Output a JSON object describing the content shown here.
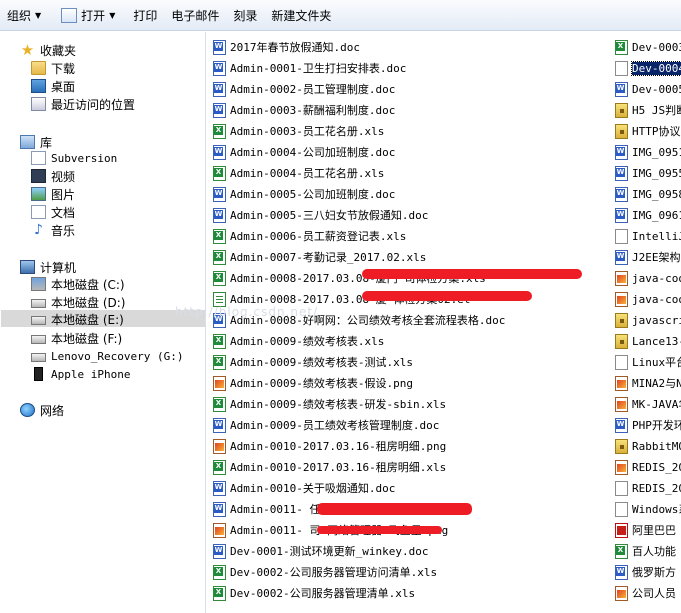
{
  "toolbar": {
    "organize": "组织",
    "open": "打开",
    "print": "打印",
    "email": "电子邮件",
    "burn": "刻录",
    "new_folder": "新建文件夹"
  },
  "nav": {
    "favorites": {
      "title": "收藏夹",
      "items": [
        "下载",
        "桌面",
        "最近访问的位置"
      ]
    },
    "libraries": {
      "title": "库",
      "items": [
        "Subversion",
        "视频",
        "图片",
        "文档",
        "音乐"
      ]
    },
    "computer": {
      "title": "计算机",
      "items": [
        "本地磁盘 (C:)",
        "本地磁盘 (D:)",
        "本地磁盘 (E:)",
        "本地磁盘 (F:)",
        "Lenovo_Recovery (G:)",
        "Apple iPhone"
      ]
    },
    "network": "网络"
  },
  "files_col1": [
    {
      "name": "2017年春节放假通知.doc",
      "type": "doc"
    },
    {
      "name": "Admin-0001-卫生打扫安排表.doc",
      "type": "doc"
    },
    {
      "name": "Admin-0002-员工管理制度.doc",
      "type": "doc"
    },
    {
      "name": "Admin-0003-薪酬福利制度.doc",
      "type": "doc"
    },
    {
      "name": "Admin-0003-员工花名册.xls",
      "type": "xls"
    },
    {
      "name": "Admin-0004-公司加班制度.doc",
      "type": "doc"
    },
    {
      "name": "Admin-0004-员工花名册.xls",
      "type": "xls"
    },
    {
      "name": "Admin-0005-公司加班制度.doc",
      "type": "doc"
    },
    {
      "name": "Admin-0005-三八妇女节放假通知.doc",
      "type": "doc"
    },
    {
      "name": "Admin-0006-员工薪资登记表.xls",
      "type": "xls"
    },
    {
      "name": "Admin-0007-考勤记录_2017.02.xls",
      "type": "xls"
    },
    {
      "name": "Admin-0008-2017.03.08-厦门                    司体检方案.xls",
      "type": "xls"
    },
    {
      "name": "Admin-0008-2017.03.08-厦                      体检方案02.et",
      "type": "et"
    },
    {
      "name": "Admin-0008-好啊网：公司绩效考核全套流程表格.doc",
      "type": "doc"
    },
    {
      "name": "Admin-0009-绩效考核表.xls",
      "type": "xls"
    },
    {
      "name": "Admin-0009-绩效考核表-测试.xls",
      "type": "xls"
    },
    {
      "name": "Admin-0009-绩效考核表-假设.png",
      "type": "png"
    },
    {
      "name": "Admin-0009-绩效考核表-研发-sbin.xls",
      "type": "xls"
    },
    {
      "name": "Admin-0009-员工绩效考核管理制度.doc",
      "type": "doc"
    },
    {
      "name": "Admin-0010-2017.03.16-租房明细.png",
      "type": "png"
    },
    {
      "name": "Admin-0010-2017.03.16-租房明细.xls",
      "type": "xls"
    },
    {
      "name": "Admin-0010-关于吸烟通知.doc",
      "type": "doc"
    },
    {
      "name": "Admin-0011-                           任命书.doc",
      "type": "doc"
    },
    {
      "name": "Admin-0011-                      司-网络管理器-飞鱼星.png",
      "type": "png"
    },
    {
      "name": "Dev-0001-测试环境更新_winkey.doc",
      "type": "doc"
    },
    {
      "name": "Dev-0002-公司服务器管理访问清单.xls",
      "type": "xls"
    },
    {
      "name": "Dev-0002-公司服务器管理清单.xls",
      "type": "xls"
    }
  ],
  "files_col2": [
    {
      "name": "Dev-0003",
      "type": "xls"
    },
    {
      "name": "Dev-0004",
      "type": "file",
      "selected": true
    },
    {
      "name": "Dev-0005",
      "type": "doc"
    },
    {
      "name": "H5 JS判断",
      "type": "lock"
    },
    {
      "name": "HTTP协议",
      "type": "lock"
    },
    {
      "name": "IMG_0951",
      "type": "doc"
    },
    {
      "name": "IMG_0955",
      "type": "doc"
    },
    {
      "name": "IMG_0958",
      "type": "doc"
    },
    {
      "name": "IMG_0961",
      "type": "doc"
    },
    {
      "name": "IntelliJ",
      "type": "file"
    },
    {
      "name": "J2EE架构",
      "type": "doc"
    },
    {
      "name": "java-coo",
      "type": "png"
    },
    {
      "name": "java-coo",
      "type": "png"
    },
    {
      "name": "javascri",
      "type": "lock"
    },
    {
      "name": "Lance13-",
      "type": "lock"
    },
    {
      "name": "Linux平台",
      "type": "file"
    },
    {
      "name": "MINA2与N",
      "type": "png"
    },
    {
      "name": "MK-JAVA华",
      "type": "png"
    },
    {
      "name": "PHP开发环",
      "type": "doc"
    },
    {
      "name": "RabbitMQ",
      "type": "lock"
    },
    {
      "name": "REDIS_20",
      "type": "png"
    },
    {
      "name": "REDIS_20",
      "type": "file"
    },
    {
      "name": "Windows系",
      "type": "file"
    },
    {
      "name": "阿里巴巴",
      "type": "pdf"
    },
    {
      "name": "百人功能",
      "type": "xls"
    },
    {
      "name": "俄罗斯方",
      "type": "doc"
    },
    {
      "name": "公司人员",
      "type": "png"
    }
  ],
  "watermark": "http://blog.csdn.net/"
}
